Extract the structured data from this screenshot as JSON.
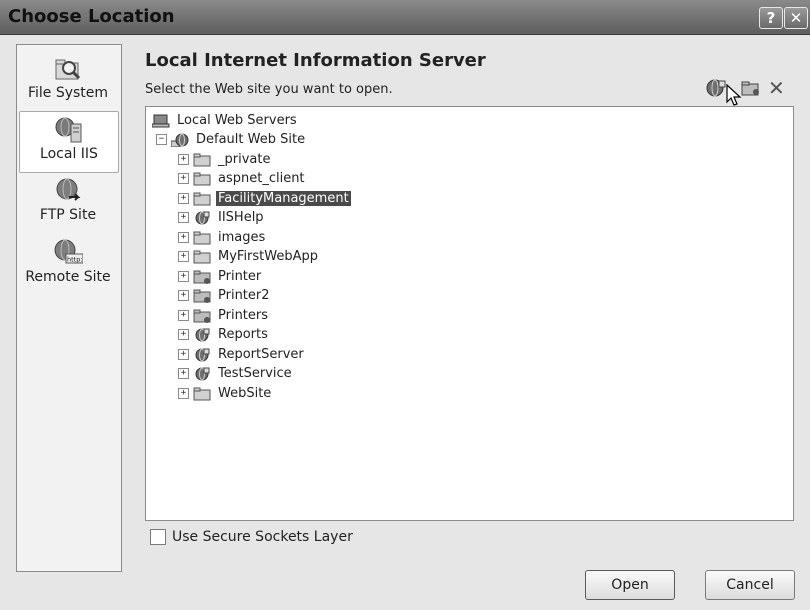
{
  "window": {
    "title": "Choose Location",
    "help_label": "?",
    "close_label": "✕"
  },
  "places": [
    {
      "label": "File System",
      "icon": "magnifier-folder-icon",
      "selected": false
    },
    {
      "label": "Local IIS",
      "icon": "iis-server-icon",
      "selected": true
    },
    {
      "label": "FTP Site",
      "icon": "ftp-globe-icon",
      "selected": false
    },
    {
      "label": "Remote Site",
      "icon": "http-globe-icon",
      "selected": false
    }
  ],
  "main": {
    "heading": "Local Internet Information Server",
    "instruction": "Select the Web site you want to open.",
    "toolbar": [
      "create-web-application-icon",
      "create-virtual-directory-icon",
      "delete-icon"
    ],
    "tree": {
      "root": "Local Web Servers",
      "site": "Default Web Site",
      "children": [
        {
          "label": "_private",
          "icon": "folder-icon"
        },
        {
          "label": "aspnet_client",
          "icon": "folder-icon"
        },
        {
          "label": "FacilityManagement",
          "icon": "folder-icon",
          "selected": true
        },
        {
          "label": "IISHelp",
          "icon": "web-app-globe-icon"
        },
        {
          "label": "images",
          "icon": "folder-icon"
        },
        {
          "label": "MyFirstWebApp",
          "icon": "folder-icon"
        },
        {
          "label": "Printer",
          "icon": "virtual-dir-icon"
        },
        {
          "label": "Printer2",
          "icon": "virtual-dir-icon"
        },
        {
          "label": "Printers",
          "icon": "virtual-dir-icon"
        },
        {
          "label": "Reports",
          "icon": "web-app-globe-icon"
        },
        {
          "label": "ReportServer",
          "icon": "web-app-globe-icon"
        },
        {
          "label": "TestService",
          "icon": "web-app-globe-icon"
        },
        {
          "label": "WebSite",
          "icon": "folder-icon"
        }
      ]
    },
    "ssl_label": "Use Secure Sockets Layer",
    "ssl_checked": false
  },
  "buttons": {
    "open": "Open",
    "cancel": "Cancel"
  }
}
